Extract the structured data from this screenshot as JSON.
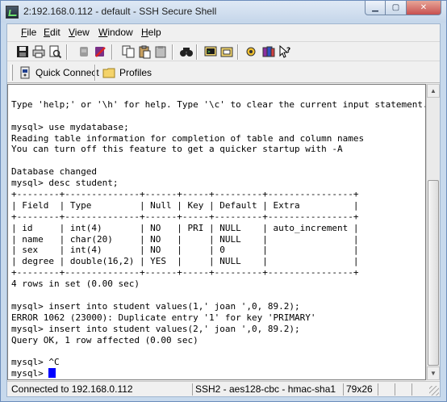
{
  "window": {
    "title": "2:192.168.0.112 - default - SSH Secure Shell",
    "controls": {
      "minimize": "▁",
      "maximize": "▢",
      "close": "✕"
    }
  },
  "menu": [
    {
      "key": "F",
      "rest": "ile"
    },
    {
      "key": "E",
      "rest": "dit"
    },
    {
      "key": "V",
      "rest": "iew"
    },
    {
      "key": "W",
      "rest": "indow"
    },
    {
      "key": "H",
      "rest": "elp"
    }
  ],
  "toolbar": {
    "icons": [
      "save-icon",
      "print-icon",
      "print-preview-icon",
      "disconnect-icon",
      "disconnect-profile-icon",
      "copy-icon",
      "paste-icon",
      "paste-file-icon",
      "find-icon",
      "new-terminal-icon",
      "new-file-transfer-icon",
      "settings-icon",
      "help-topics-icon",
      "context-help-icon"
    ]
  },
  "quickbar": {
    "quick_connect": "Quick Connect",
    "profiles": "Profiles"
  },
  "terminal": {
    "lines": [
      "",
      "Type 'help;' or '\\h' for help. Type '\\c' to clear the current input statement.",
      "",
      "mysql> use mydatabase;",
      "Reading table information for completion of table and column names",
      "You can turn off this feature to get a quicker startup with -A",
      "",
      "Database changed",
      "mysql> desc student;",
      "+--------+--------------+------+-----+---------+----------------+",
      "| Field  | Type         | Null | Key | Default | Extra          |",
      "+--------+--------------+------+-----+---------+----------------+",
      "| id     | int(4)       | NO   | PRI | NULL    | auto_increment |",
      "| name   | char(20)     | NO   |     | NULL    |                |",
      "| sex    | int(4)       | NO   |     | 0       |                |",
      "| degree | double(16,2) | YES  |     | NULL    |                |",
      "+--------+--------------+------+-----+---------+----------------+",
      "4 rows in set (0.00 sec)",
      "",
      "mysql> insert into student values(1,' joan ',0, 89.2);",
      "ERROR 1062 (23000): Duplicate entry '1' for key 'PRIMARY'",
      "mysql> insert into student values(2,' joan ',0, 89.2);",
      "Query OK, 1 row affected (0.00 sec)",
      "",
      "mysql> ^C"
    ],
    "prompt": "mysql> "
  },
  "status": {
    "connection": "Connected to 192.168.0.112",
    "cipher": "SSH2 - aes128-cbc - hmac-sha1",
    "size": "79x26"
  }
}
